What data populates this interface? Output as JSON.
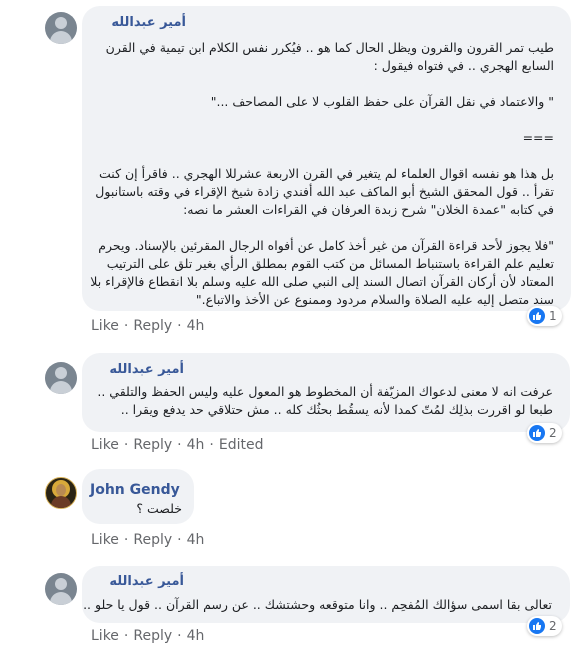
{
  "comments": [
    {
      "author": "أمير عبدالله",
      "lines": [
        "طيب تمر القرون والقرون ويظل الحال كما هو .. فيُكرر نفس الكلام ابن تيمية في القرن",
        "السابع الهجري .. في فتواه فيقول :",
        "",
        "\" والاعتماد في نقل القرآن على حفظ القلوب لا على المصاحف ...\"",
        "",
        "===",
        "",
        "بل هذا هو نفسه اقوال العلماء لم يتغير في القرن الاربعة عشرللا الهجري .. فاقرأ إن كنت",
        "تقرأ .. قول المحقق الشيخ أبو الماكف عبد الله أفندي زادة شيخ الإقراء في وقته باستانبول",
        "في كتابه \"عمدة الخلان\" شرح زبدة العرفان في القراءات العشر ما نصه:",
        "",
        "\"فلا يجوز لأحد قراءة القرآن من غير أخذ كامل عن أفواه الرجال المقرئين بالإسناد. ويحرم",
        "تعليم علم القراءة باستنباط المسائل من كتب القوم بمطلق الرأي بغير تلق على الترتيب",
        "المعتاد لأن أركان القرآن اتصال السند إلى النبي صلى الله عليه وسلم بلا انقطاع فالإقراء بلا",
        "سند متصل إليه عليه الصلاة والسلام مردود وممنوع عن الأخذ والاتباع.\""
      ],
      "reactions": "1",
      "like_label": "Like",
      "reply_label": "Reply",
      "time": "4h",
      "edited": ""
    },
    {
      "author": "أمير عبدالله",
      "lines": [
        "عرفت انه لا معنى لدعواك المزيّفة أن المخطوط هو المعول عليه وليس الحفظ والتلقي ..",
        "طبعا لو اقررت بذلِك لمُتّ كمدا لأنه يسقُط بحثُك كله .. مش حتلاقي حد يدفع ويقرا .."
      ],
      "reactions": "2",
      "like_label": "Like",
      "reply_label": "Reply",
      "time": "4h",
      "edited": "Edited"
    },
    {
      "author": "John Gendy",
      "lines": [
        "خلصت ؟"
      ],
      "reactions": "",
      "like_label": "Like",
      "reply_label": "Reply",
      "time": "4h",
      "edited": ""
    },
    {
      "author": "أمير عبدالله",
      "lines": [
        "تعالى بقا اسمى سؤالك المُفحِم .. وانا متوقعه وحشتشك .. عن رسم القرآن .. قول يا حلو .."
      ],
      "reactions": "2",
      "like_label": "Like",
      "reply_label": "Reply",
      "time": "4h",
      "edited": ""
    }
  ],
  "colors": {
    "author": "#385898",
    "bubble": "#f0f2f5",
    "like": "#1877f2",
    "meta": "#65676b"
  },
  "icons": {
    "reaction": "thumbs-up-icon",
    "avatar_default": "default-avatar-icon",
    "avatar_john": "icon-avatar"
  }
}
